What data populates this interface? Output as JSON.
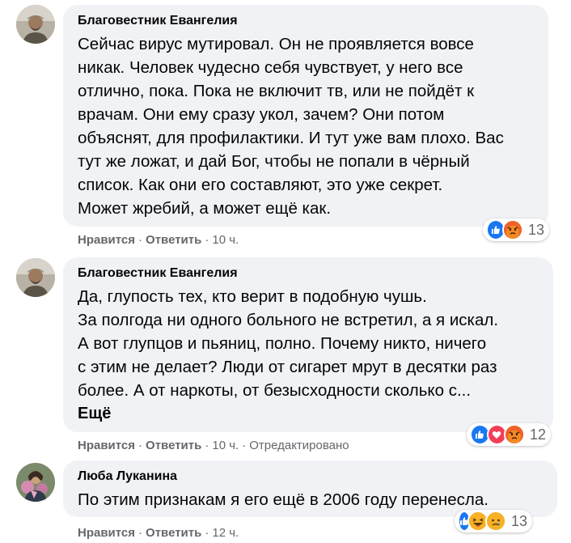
{
  "comments": [
    {
      "author": "Благовестник Евангелия",
      "text": "Сейчас вирус мутировал. Он не проявляется вовсе\nникак. Человек чудесно себя чувствует, у него все\nотлично, пока. Пока не включит тв, или не пойдёт к\nврачам. Они ему сразу укол, зачем? Они потом\nобъяснят, для профилактики. И тут уже вам плохо. Вас\nтут же ложат, и дай Бог, чтобы не попали в чёрный\nсписок. Как они его составляют, это уже секрет.\nМожет жребий, а может ещё как.",
      "reactions": [
        "like",
        "angry"
      ],
      "reaction_count": "13",
      "like_label": "Нравится",
      "reply_label": "Ответить",
      "time": "10 ч.",
      "edited": ""
    },
    {
      "author": "Благовестник Евангелия",
      "text": "Да, глупость тех, кто верит в подобную чушь.\nЗа полгода ни одного больного не встретил, а я искал.\nА вот глупцов и пьяниц, полно. Почему никто, ничего\nс этим не делает? Люди от сигарет мрут в десятки раз\nболее. А от наркоты, от безысходности сколько с...",
      "more_label": "Ещё",
      "reactions": [
        "like",
        "love",
        "angry"
      ],
      "reaction_count": "12",
      "like_label": "Нравится",
      "reply_label": "Ответить",
      "time": "10 ч.",
      "edited": "Отредактировано"
    },
    {
      "author": "Люба Луканина",
      "text": "По этим признакам я его ещё в 2006 году перенесла.",
      "reactions": [
        "like",
        "haha",
        "sad"
      ],
      "reaction_count": "13",
      "like_label": "Нравится",
      "reply_label": "Ответить",
      "time": "12 ч.",
      "edited": ""
    }
  ],
  "colors": {
    "like": "#1877f2",
    "love": "#f33e58",
    "angry": "#e9710f",
    "haha": "#f7b125",
    "bubble": "#f0f2f5",
    "meta": "#65676b"
  }
}
